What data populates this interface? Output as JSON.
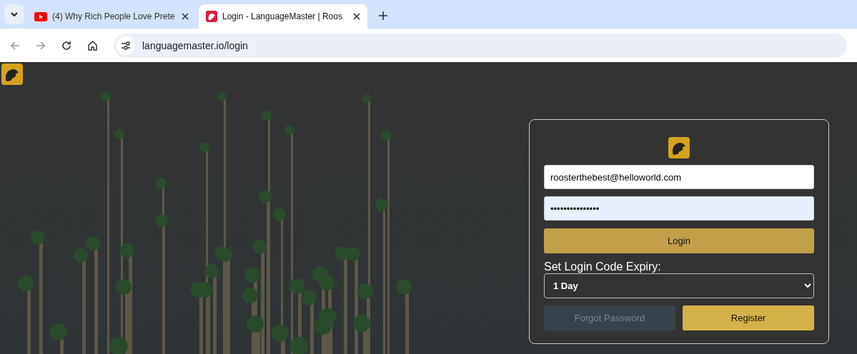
{
  "browser": {
    "tabs": [
      {
        "title": "(4) Why Rich People Love Prete",
        "kind": "video",
        "selected": false
      },
      {
        "title": "Login - LanguageMaster | Roos",
        "kind": "app",
        "selected": true
      }
    ],
    "url": "languagemaster.io/login"
  },
  "login_form": {
    "email": "roosterthebest@helloworld.com",
    "password": "•••••••••••••••",
    "login_button": "Login",
    "expiry_label": "Set Login Code Expiry:",
    "expiry_value": "1 Day",
    "buttons": [
      {
        "label": "Forgot Password",
        "disabled": true
      },
      {
        "label": "Register",
        "disabled": false
      }
    ]
  }
}
